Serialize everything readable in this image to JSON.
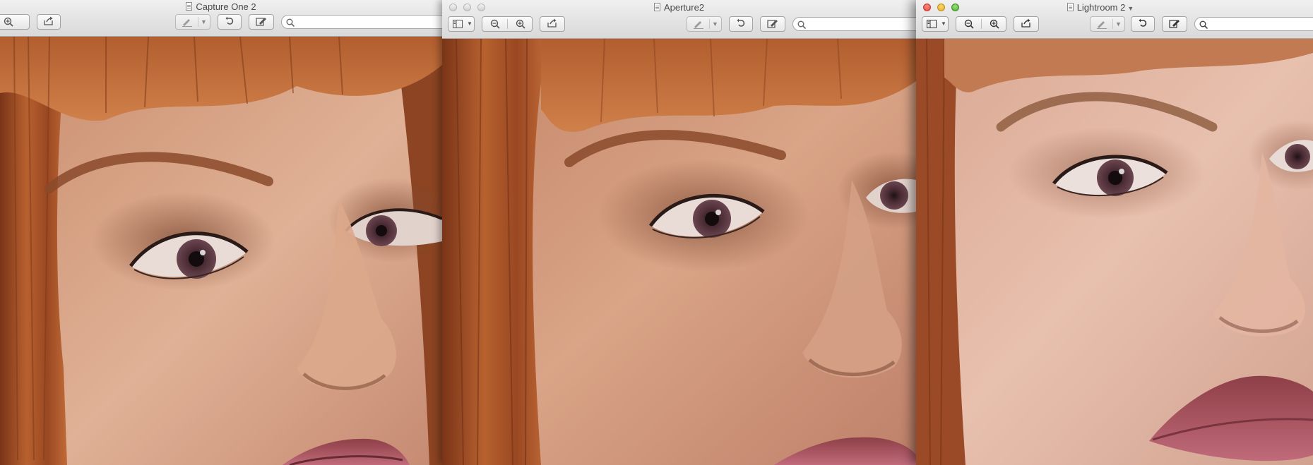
{
  "windows": [
    {
      "title": "Capture One 2",
      "search_placeholder": "",
      "image_alt": "Close-up portrait detail rendered by Capture One 2"
    },
    {
      "title": "Aperture2",
      "search_placeholder": "",
      "image_alt": "Close-up portrait detail rendered by Aperture2"
    },
    {
      "title": "Lightroom 2",
      "search_placeholder": "",
      "image_alt": "Close-up portrait detail rendered by Lightroom 2"
    }
  ],
  "icons": {
    "sidebar": "sidebar-toggle-icon",
    "zoom_out": "zoom-out-icon",
    "zoom_in": "zoom-in-icon",
    "share": "share-icon",
    "annotate": "annotate-icon",
    "rotate": "rotate-icon",
    "edit": "edit-icon",
    "search": "search-icon"
  },
  "colors": {
    "hair": "#a8542d",
    "skin": "#cf9a7b",
    "lips": "#a5505a",
    "window_close": "#e2463f",
    "window_minimize": "#e2a82a",
    "window_zoom": "#4fae33"
  }
}
